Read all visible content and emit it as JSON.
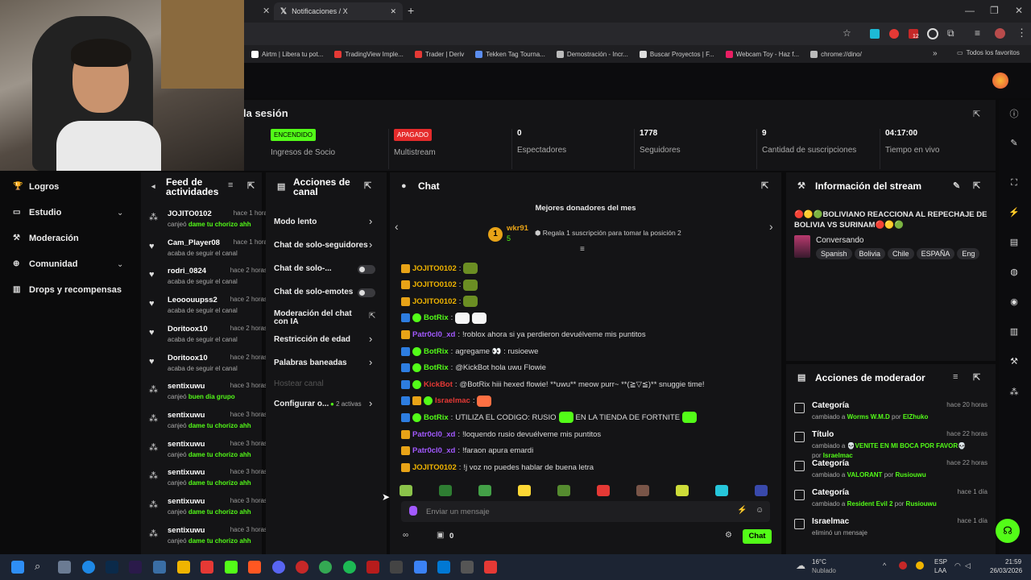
{
  "browser": {
    "tab_title": "Notificaciones / X",
    "bookmarks": [
      {
        "label": "Airtm | Libera tu pot...",
        "color": "#ffffff"
      },
      {
        "label": "TradingView Imple...",
        "color": "#e53935"
      },
      {
        "label": "Trader | Deriv",
        "color": "#e53935"
      },
      {
        "label": "Tekken Tag Tourna...",
        "color": "#5b8def"
      },
      {
        "label": "Demostración - Incr...",
        "color": "#bbbbbb"
      },
      {
        "label": "Buscar Proyectos | F...",
        "color": "#dddddd"
      },
      {
        "label": "Webcam Toy - Haz f...",
        "color": "#e91e63"
      },
      {
        "label": "chrome://dino/",
        "color": "#bbbbbb"
      }
    ],
    "all_bookmarks": "Todos los favoritos",
    "ext_badge": "12"
  },
  "session": {
    "title": "la sesión",
    "stats": [
      {
        "value": "ENCENDIDO",
        "label": "Ingresos de Socio",
        "badge_color": "#53fc18",
        "badge_text_color": "#000000"
      },
      {
        "value": "APAGADO",
        "label": "Multistream",
        "badge_color": "#e52b2b",
        "badge_text_color": "#ffffff"
      },
      {
        "value": "0",
        "label": "Espectadores"
      },
      {
        "value": "1778",
        "label": "Seguidores"
      },
      {
        "value": "9",
        "label": "Cantidad de suscripciones"
      },
      {
        "value": "04:17:00",
        "label": "Tiempo en vivo"
      }
    ]
  },
  "leftnav": [
    "Logros",
    "Estudio",
    "Moderación",
    "Comunidad",
    "Drops y recompensas"
  ],
  "feed": {
    "title": "Feed de actividades",
    "items": [
      {
        "icon": "redeem",
        "name": "JOJITO0102",
        "time": "hace 1 hora",
        "pre": "canjeó",
        "reward": "dame tu chorizo ahh",
        "desc": ""
      },
      {
        "icon": "heart",
        "name": "Cam_Player08",
        "time": "hace 1 hora",
        "pre": "",
        "reward": "",
        "desc": "acaba de seguir el canal"
      },
      {
        "icon": "heart",
        "name": "rodri_0824",
        "time": "hace 2 horas",
        "pre": "",
        "reward": "",
        "desc": "acaba de seguir el canal"
      },
      {
        "icon": "heart",
        "name": "Leooouupss2",
        "time": "hace 2 horas",
        "pre": "",
        "reward": "",
        "desc": "acaba de seguir el canal"
      },
      {
        "icon": "heart",
        "name": "Doritoox10",
        "time": "hace 2 horas",
        "pre": "",
        "reward": "",
        "desc": "acaba de seguir el canal"
      },
      {
        "icon": "heart",
        "name": "Doritoox10",
        "time": "hace 2 horas",
        "pre": "",
        "reward": "",
        "desc": "acaba de seguir el canal"
      },
      {
        "icon": "redeem",
        "name": "sentixuwu",
        "time": "hace 3 horas",
        "pre": "canjeó",
        "reward": "buen dia grupo",
        "desc": ""
      },
      {
        "icon": "redeem",
        "name": "sentixuwu",
        "time": "hace 3 horas",
        "pre": "canjeó",
        "reward": "dame tu chorizo ahh",
        "desc": ""
      },
      {
        "icon": "redeem",
        "name": "sentixuwu",
        "time": "hace 3 horas",
        "pre": "canjeó",
        "reward": "dame tu chorizo ahh",
        "desc": ""
      },
      {
        "icon": "redeem",
        "name": "sentixuwu",
        "time": "hace 3 horas",
        "pre": "canjeó",
        "reward": "dame tu chorizo ahh",
        "desc": ""
      },
      {
        "icon": "redeem",
        "name": "sentixuwu",
        "time": "hace 3 horas",
        "pre": "canjeó",
        "reward": "dame tu chorizo ahh",
        "desc": ""
      },
      {
        "icon": "redeem",
        "name": "sentixuwu",
        "time": "hace 3 horas",
        "pre": "canjeó",
        "reward": "dame tu chorizo ahh",
        "desc": ""
      }
    ]
  },
  "actions": {
    "title": "Acciones de canal",
    "items": [
      {
        "label": "Modo lento",
        "control": "arrow",
        "extra": ""
      },
      {
        "label": "Chat de solo-seguidores",
        "control": "arrow",
        "extra": ""
      },
      {
        "label": "Chat de solo-...",
        "control": "toggle",
        "extra": ""
      },
      {
        "label": "Chat de solo-emotes",
        "control": "toggle",
        "extra": ""
      },
      {
        "label": "Moderación del chat con IA",
        "control": "link",
        "extra": ""
      },
      {
        "label": "Restricción de edad",
        "control": "arrow",
        "extra": ""
      },
      {
        "label": "Palabras baneadas",
        "control": "arrow",
        "extra": ""
      },
      {
        "label": "Hostear canal",
        "control": "none",
        "extra": ""
      },
      {
        "label": "Configurar o...",
        "control": "arrow",
        "extra": "2 activas"
      }
    ]
  },
  "chat": {
    "title": "Chat",
    "donors_title": "Mejores donadores del mes",
    "top_donor": {
      "rank": "1",
      "name": "wkr91",
      "count": "5"
    },
    "gift_text": "Regala 1 suscripción para tomar la posición 2",
    "messages": [
      {
        "badges": [
          "crown"
        ],
        "user": "JOJITO0102",
        "color": "#f0b400",
        "text": "",
        "emotes": 1
      },
      {
        "badges": [
          "crown"
        ],
        "user": "JOJITO0102",
        "color": "#f0b400",
        "text": "",
        "emotes": 1
      },
      {
        "badges": [
          "crown"
        ],
        "user": "JOJITO0102",
        "color": "#f0b400",
        "text": "",
        "emotes": 1
      },
      {
        "badges": [
          "pin",
          "verif"
        ],
        "user": "BotRix",
        "color": "#53fc18",
        "text": "",
        "emotes": 2
      },
      {
        "badges": [
          "crown"
        ],
        "user": "Patr0cl0_xd",
        "color": "#a259ff",
        "text": "!roblox ahora si ya perdieron devuélveme mis puntitos",
        "emotes": 0
      },
      {
        "badges": [
          "pin",
          "verif"
        ],
        "user": "BotRix",
        "color": "#53fc18",
        "text": "agregame 👀 : rusioewe",
        "emotes": 0
      },
      {
        "badges": [
          "pin",
          "verif"
        ],
        "user": "BotRix",
        "color": "#53fc18",
        "text": "@KickBot hola uwu Flowie",
        "emotes": 0
      },
      {
        "badges": [
          "pin",
          "verif"
        ],
        "user": "KickBot",
        "color": "#e53935",
        "text": "@BotRix hiii hexed flowie! **uwu** meow purr~ **(≧▽≦)** snuggie time!",
        "emotes": 0
      },
      {
        "badges": [
          "pin",
          "crown",
          "verif"
        ],
        "user": "Israelmac",
        "color": "#e53935",
        "text": "",
        "emotes": 1
      },
      {
        "badges": [
          "pin",
          "verif"
        ],
        "user": "BotRix",
        "color": "#53fc18",
        "text": "UTILIZA EL CODIGO: RUSIO",
        "emotes": 0,
        "tail": "EN LA TIENDA DE FORTNITE"
      },
      {
        "badges": [
          "crown"
        ],
        "user": "Patr0cl0_xd",
        "color": "#a259ff",
        "text": "!loquendo rusio devuélveme mis puntitos",
        "emotes": 0
      },
      {
        "badges": [
          "crown"
        ],
        "user": "Patr0cl0_xd",
        "color": "#a259ff",
        "text": "!faraon apura emardi",
        "emotes": 0
      },
      {
        "badges": [
          "crown"
        ],
        "user": "JOJITO0102",
        "color": "#f0b400",
        "text": "!j voz no puedes hablar de buena letra",
        "emotes": 0
      }
    ],
    "input_placeholder": "Enviar un mensaje",
    "points": "0",
    "send_label": "Chat"
  },
  "stream_info": {
    "title": "Información del stream",
    "stream_title": "🔴🟡🟢BOLIVIANO REACCIONA AL REPECHAJE DE BOLIVIA VS SURINAM🔴🟡🟢",
    "category": "Conversando",
    "tags": [
      "Spanish",
      "Bolivia",
      "Chile",
      "ESPAÑA",
      "Eng"
    ]
  },
  "mod_actions": {
    "title": "Acciones de moderador",
    "items": [
      {
        "title": "Categoría",
        "time": "hace 20 horas",
        "pre": "cambiado a",
        "value": "Worms W.M.D",
        "by": "ElZhuko"
      },
      {
        "title": "Título",
        "time": "hace 22 horas",
        "pre": "cambiado a",
        "value": "💀VENITE EN MI BOCA POR FAVOR💀",
        "by": "Israelmac"
      },
      {
        "title": "Categoría",
        "time": "hace 22 horas",
        "pre": "cambiado a",
        "value": "VALORANT",
        "by": "Rusiouwu"
      },
      {
        "title": "Categoría",
        "time": "hace 1 día",
        "pre": "cambiado a",
        "value": "Resident Evil 2",
        "by": "Rusiouwu"
      },
      {
        "title": "Israelmac",
        "time": "hace 1 día",
        "pre": "eliminó un mensaje",
        "value": "",
        "by": ""
      }
    ],
    "by_word": "por"
  },
  "taskbar": {
    "weather_temp": "16°C",
    "weather_desc": "Nublado",
    "lang": "ESP",
    "lang2": "LAA",
    "time": "21:59",
    "date": "26/03/2026"
  },
  "colors": {
    "accent": "#53fc18",
    "panel": "#141416"
  }
}
